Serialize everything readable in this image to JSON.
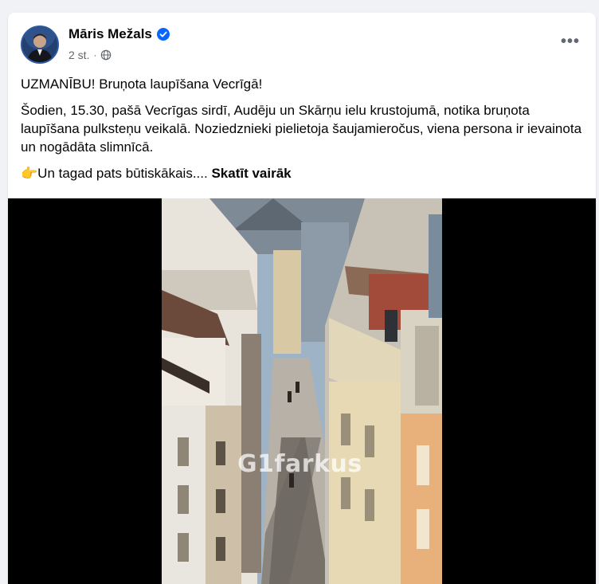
{
  "post": {
    "author": "Māris Mežals",
    "time": "2 st.",
    "dot": "·",
    "audience_icon": "globe-icon",
    "verified_icon": "verified-badge-icon",
    "more_icon": "more-options-icon",
    "more_label": "•••",
    "headline": "UZMANĪBU! Bruņota laupīšana Vecrīgā!",
    "paragraph": "Šodien, 15.30, pašā Vecrīgas sirdī, Audēju un Skārņu ielu krustojumā, notika bruņota laupīšana pulksteņu veikalā. Noziedznieki pielietoja šaujamieročus, viena persona ir ievainota un nogādāta slimnīcā.",
    "teaser": "👉Un tagad pats būtiskākais.... ",
    "see_more": "Skatīt vairāk"
  },
  "media": {
    "watermark": "G1farkus"
  },
  "colors": {
    "background": "#f0f2f5",
    "card": "#ffffff",
    "text": "#050505",
    "secondary": "#65676b",
    "verified": "#0866ff",
    "video_bg": "#000000"
  }
}
